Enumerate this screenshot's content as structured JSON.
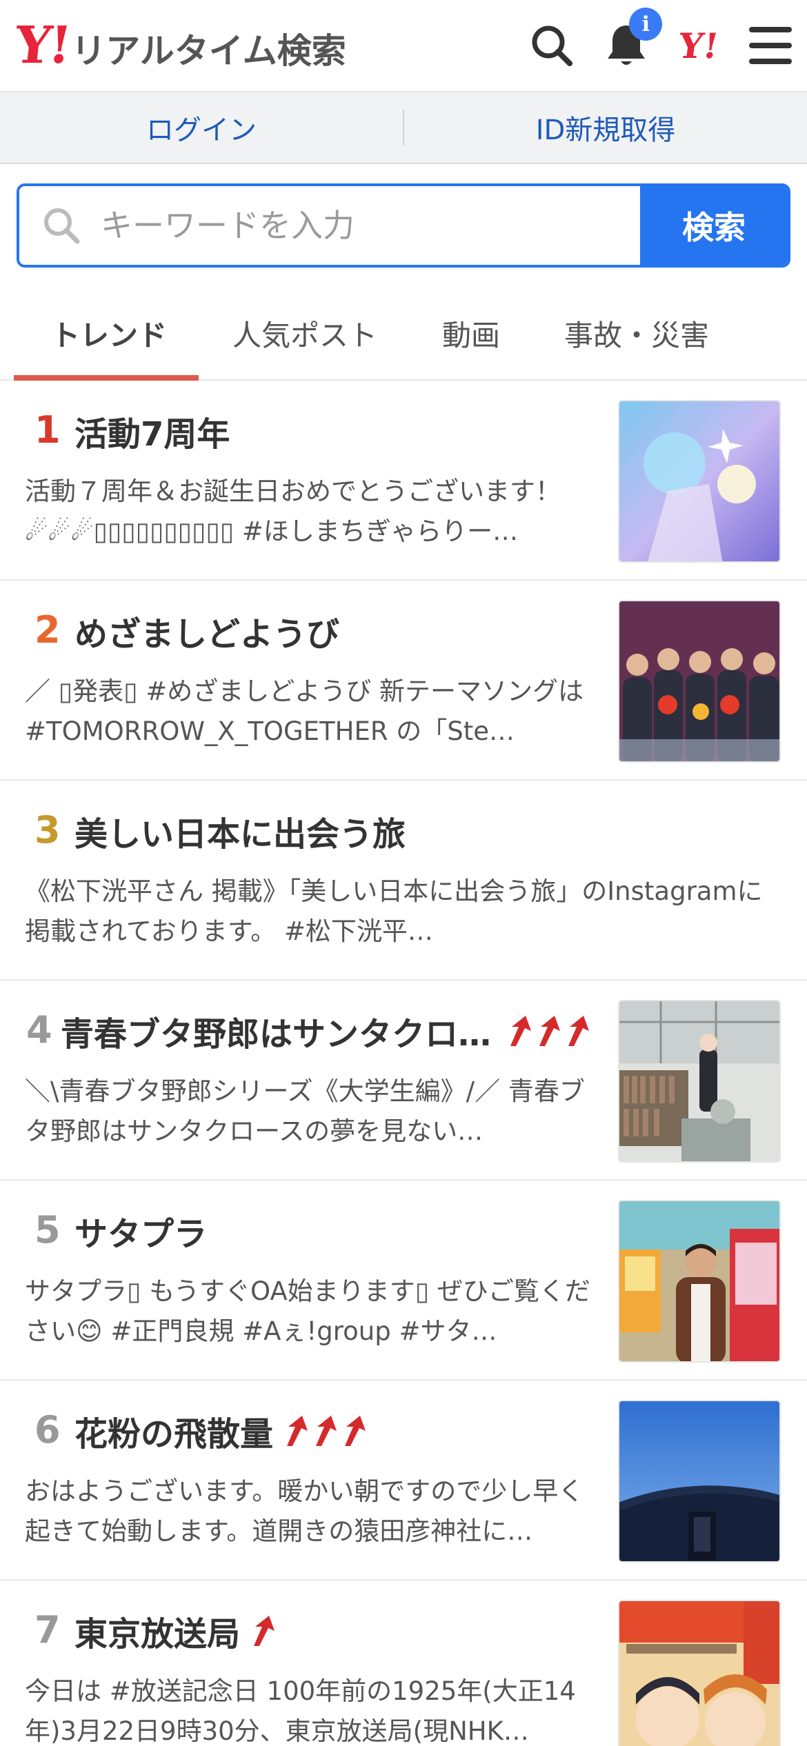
{
  "header": {
    "logo_mark": "Y!",
    "logo_text": "リアルタイム検索",
    "notification_badge": "i",
    "yahoo_mark": "Y!"
  },
  "auth": {
    "login": "ログイン",
    "register": "ID新規取得"
  },
  "search": {
    "placeholder": "キーワードを入力",
    "button": "検索"
  },
  "tabs": [
    {
      "label": "トレンド",
      "active": true
    },
    {
      "label": "人気ポスト",
      "active": false
    },
    {
      "label": "動画",
      "active": false
    },
    {
      "label": "事故・災害",
      "active": false
    }
  ],
  "colors": {
    "accent": "#2575f0",
    "brand_red": "#e8243a",
    "rank1": "#d9382a",
    "rank2": "#e8682c",
    "rank3": "#c49a2c",
    "rank_other": "#999999",
    "up_arrow": "#d42a2a"
  },
  "trends": [
    {
      "rank": "1",
      "title": "活動7周年",
      "desc": "活動７周年＆お誕生日おめでとうございます！☄☄☄▯▯▯▯▯▯▯▯▯▯ #ほしまちぎゃらりー…",
      "rising": false
    },
    {
      "rank": "2",
      "title": "めざましどようび",
      "desc": "／ ▯発表▯ #めざましどようび 新テーマソングは #TOMORROW_X_TOGETHER の「Ste…",
      "rising": false
    },
    {
      "rank": "3",
      "title": "美しい日本に出会う旅",
      "desc": "《松下洸平さん 掲載》「美しい日本に出会う旅」のInstagramに掲載されております。 #松下洸平…",
      "rising": false
    },
    {
      "rank": "4",
      "title": "青春ブタ野郎はサンタクロ…",
      "desc": "＼\\青春ブタ野郎シリーズ《大学生編》/／ 青春ブタ野郎はサンタクロースの夢を見ない…",
      "rising": true
    },
    {
      "rank": "5",
      "title": "サタプラ",
      "desc": "サタプラ▯ もうすぐOA始まります▯ ぜひご覧ください😊 #正門良規 #Aぇ!group #サタ…",
      "rising": false
    },
    {
      "rank": "6",
      "title": "花粉の飛散量",
      "desc": "おはようございます。暖かい朝ですので少し早く起きて始動します。道開きの猿田彦神社に…",
      "rising": true
    },
    {
      "rank": "7",
      "title": "東京放送局",
      "desc": "今日は #放送記念日 100年前の1925年(大正14年)3月22日9時30分、東京放送局(現NHK…",
      "rising": true
    }
  ]
}
